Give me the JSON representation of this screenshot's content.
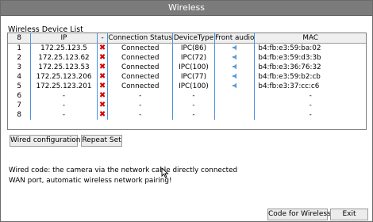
{
  "window": {
    "title": "Wireless"
  },
  "section": {
    "label": "Wireless Device List"
  },
  "table": {
    "headers": {
      "count": "8",
      "ip": "IP",
      "state": "-",
      "status": "Connection Status",
      "device": "DeviceType",
      "audio": "Front audio",
      "mac": "MAC"
    },
    "rows": [
      {
        "no": "1",
        "ip": "172.25.123.5",
        "status": "Connected",
        "device": "IPC(86)",
        "audio": true,
        "mac": "b4:fb:e3:59:ba:02"
      },
      {
        "no": "2",
        "ip": "172.25.123.62",
        "status": "Connected",
        "device": "IPC(72)",
        "audio": true,
        "mac": "b4:fb:e3:59:d3:3b"
      },
      {
        "no": "3",
        "ip": "172.25.123.53",
        "status": "Connected",
        "device": "IPC(100)",
        "audio": true,
        "mac": "b4:fb:e3:36:76:32"
      },
      {
        "no": "4",
        "ip": "172.25.123.206",
        "status": "Connected",
        "device": "IPC(77)",
        "audio": true,
        "mac": "b4:fb:e3:59:b2:cb"
      },
      {
        "no": "5",
        "ip": "172.25.123.201",
        "status": "Connected",
        "device": "IPC(100)",
        "audio": true,
        "mac": "b4:fb:e3:37:cc:c6"
      },
      {
        "no": "6",
        "ip": "-",
        "status": "-",
        "device": "-",
        "audio": false,
        "mac": "-"
      },
      {
        "no": "7",
        "ip": "-",
        "status": "-",
        "device": "-",
        "audio": false,
        "mac": "-"
      },
      {
        "no": "8",
        "ip": "-",
        "status": "-",
        "device": "-",
        "audio": false,
        "mac": "-"
      }
    ]
  },
  "buttons": {
    "wired_config": "Wired configuration",
    "repeat_set": "Repeat Set",
    "code_for_wireless": "Code for Wireless",
    "exit": "Exit"
  },
  "note": "Wired code: the camera via the network cable directly connected WAN port, automatic wireless network pairing!",
  "icons": {
    "row_state": "x-mark-icon",
    "audio": "speaker-icon",
    "pointer": "mouse-cursor-icon"
  },
  "colors": {
    "titlebar": "#7b7b7b",
    "x_mark": "#d40000",
    "speaker": "#5b9bd5",
    "column_divider": "#4a90e2"
  }
}
